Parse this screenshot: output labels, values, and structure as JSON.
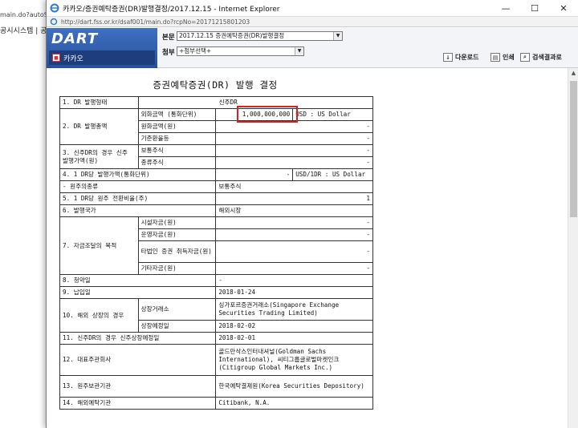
{
  "background": {
    "url_fragment": "main.do?autoSear",
    "tab_text": "공시시스템 | 공시서"
  },
  "window": {
    "title": "카카오/증권예탁증권(DR)발행결정/2017.12.15 - Internet Explorer",
    "url": "http://dart.fss.or.kr/dsaf001/main.do?rcpNo=20171215801203",
    "controls": {
      "minimize": "—",
      "maximize": "☐",
      "close": "✕"
    }
  },
  "header": {
    "logo": "DART",
    "company": "카카오",
    "report_label": "본문",
    "report_value": "2017.12.15  증권예탁증권(DR)발행결정",
    "attach_label": "첨부",
    "attach_value": "+첨부선택+",
    "buttons": {
      "download": "다운로드",
      "print": "인쇄",
      "search_results": "검색결과로"
    }
  },
  "document": {
    "title": "증권예탁증권(DR) 발행 결정",
    "highlight_color": "#d42121",
    "r1": {
      "label": "1. DR 발행형태",
      "value": "신주DR"
    },
    "r2": {
      "label": "2. DR 발행총액",
      "sub1": "외화금액 (통화단위)",
      "sub1_value": "1,000,000,000",
      "sub1_unit": "USD : US Dollar",
      "sub2": "원화금액(원)",
      "sub2_value": "-",
      "sub3": "기준환율등",
      "sub3_value": "-"
    },
    "r3": {
      "label": "3. 신주DR의 경우 신주 발행가액(원)",
      "sub1": "보통주식",
      "sub1_value": "-",
      "sub2": "종류주식",
      "sub2_value": "-"
    },
    "r4": {
      "label": "4. 1 DR당 발행가액(통화단위)",
      "value": "-",
      "unit": "USD/1DR : US Dollar"
    },
    "r4b": {
      "label": "- 원주의종류",
      "value": "보통주식"
    },
    "r5": {
      "label": "5. 1 DR당 원주 전환비율(주)",
      "value": "1"
    },
    "r6": {
      "label": "6. 발행국가",
      "value": "해외시장"
    },
    "r7": {
      "label": "7. 자금조달의 목적",
      "sub1": "시설자금(원)",
      "sub1_value": "-",
      "sub2": "운영자금(원)",
      "sub2_value": "-",
      "sub3": "타법인 증권 취득자금(원)",
      "sub3_value": "-",
      "sub4": "기타자금(원)",
      "sub4_value": "-"
    },
    "r8": {
      "label": "8. 청약일",
      "value": "-"
    },
    "r9": {
      "label": "9. 납입일",
      "value": "2018-01-24"
    },
    "r10": {
      "label": "10. 해외 상장의 경우",
      "sub1": "상장거래소",
      "sub1_value": "싱가포르증권거래소(Singapore Exchange Securities Trading Limited)",
      "sub2": "상장예정일",
      "sub2_value": "2018-02-02"
    },
    "r11": {
      "label": "11. 신주DR의 경우 신주상장예정일",
      "value": "2018-02-01"
    },
    "r12": {
      "label": "12. 대표주관회사",
      "value": "골드만삭스인터내셔널(Goldman Sachs International), 씨티그룹글로벌마켓인크(Citigroup Global Markets Inc.)"
    },
    "r13": {
      "label": "13. 원주보관기관",
      "value": "한국예탁결제원(Korea Securities Depository)"
    },
    "r14": {
      "label": "14. 해외예탁기관",
      "value": "Citibank, N.A."
    }
  }
}
